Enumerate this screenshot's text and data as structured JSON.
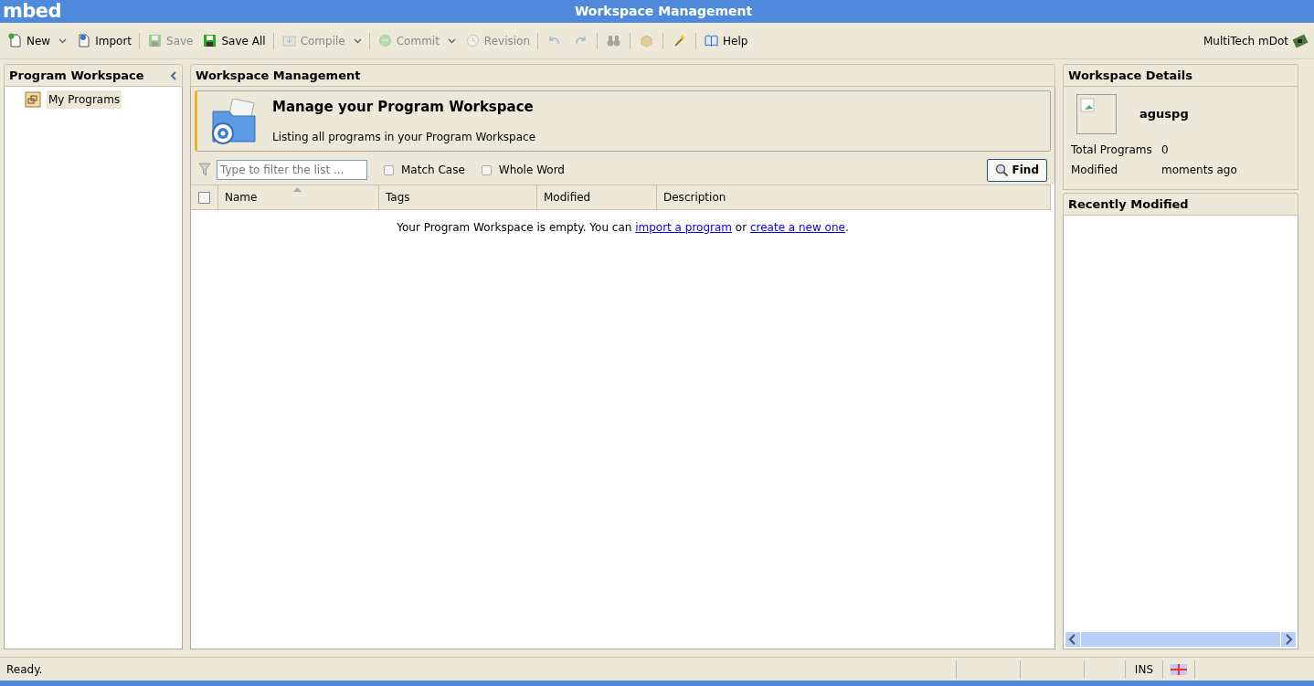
{
  "window": {
    "logo": "mbed",
    "title": "Workspace Management"
  },
  "toolbar": [
    {
      "kind": "button",
      "label": "New",
      "disabled": false,
      "dropdown": true
    },
    {
      "kind": "button",
      "label": "Import",
      "disabled": false,
      "dropdown": false
    },
    {
      "kind": "separator"
    },
    {
      "kind": "button",
      "label": "Save",
      "disabled": true,
      "dropdown": false
    },
    {
      "kind": "button",
      "label": "Save All",
      "disabled": false,
      "dropdown": false
    },
    {
      "kind": "separator"
    },
    {
      "kind": "button",
      "label": "Compile",
      "disabled": true,
      "dropdown": true
    },
    {
      "kind": "separator"
    },
    {
      "kind": "button",
      "label": "Commit",
      "disabled": true,
      "dropdown": true
    },
    {
      "kind": "button",
      "label": "Revision",
      "disabled": true,
      "dropdown": false
    },
    {
      "kind": "separator"
    },
    {
      "kind": "icon",
      "disabled": true
    },
    {
      "kind": "icon",
      "disabled": true
    },
    {
      "kind": "separator"
    },
    {
      "kind": "icon",
      "disabled": true
    },
    {
      "kind": "separator"
    },
    {
      "kind": "icon",
      "disabled": true
    },
    {
      "kind": "separator"
    },
    {
      "kind": "icon",
      "disabled": false
    },
    {
      "kind": "separator"
    },
    {
      "kind": "button",
      "label": "Help",
      "disabled": false,
      "dropdown": false
    }
  ],
  "platform": "MultiTech mDot",
  "sidebar": {
    "title": "Program Workspace",
    "items": [
      {
        "label": "My Programs",
        "selected": true
      }
    ]
  },
  "main": {
    "title": "Workspace Management",
    "banner": {
      "heading": "Manage your Program Workspace",
      "subtitle": "Listing all programs in your Program Workspace"
    },
    "filter": {
      "placeholder": "Type to filter the list ...",
      "options": [
        {
          "label": "Match Case",
          "checked": false
        },
        {
          "label": "Whole Word",
          "checked": false
        }
      ],
      "button": "Find"
    },
    "table": {
      "select_all_checked": false,
      "columns": [
        {
          "label": "Name",
          "sorted": true
        },
        {
          "label": "Tags",
          "sorted": false
        },
        {
          "label": "Modified",
          "sorted": false
        },
        {
          "label": "Description",
          "sorted": false
        }
      ],
      "empty_message": [
        {
          "kind": "text",
          "text": "Your Program Workspace is empty. You can "
        },
        {
          "kind": "link",
          "text": "import a program"
        },
        {
          "kind": "text",
          "text": " or "
        },
        {
          "kind": "link",
          "text": "create a new one"
        },
        {
          "kind": "text",
          "text": "."
        }
      ]
    }
  },
  "details": {
    "title": "Workspace Details",
    "user": "aguspg",
    "fields": [
      {
        "label": "Total Programs",
        "value": "0"
      },
      {
        "label": "Modified",
        "value": "moments ago"
      }
    ],
    "recent_title": "Recently Modified"
  },
  "status_bar": {
    "message": "Ready.",
    "mode": "INS"
  }
}
